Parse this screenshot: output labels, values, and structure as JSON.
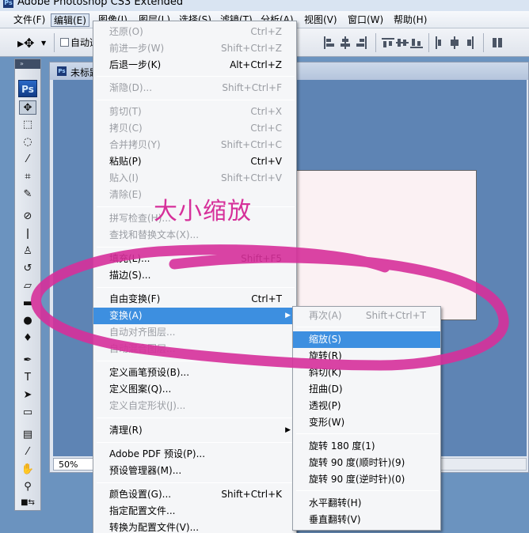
{
  "window": {
    "title": "Adobe Photoshop CS3 Extended",
    "logo_text": "Ps"
  },
  "menubar": [
    {
      "label": "文件(F)"
    },
    {
      "label": "编辑(E)"
    },
    {
      "label": "图像(I)"
    },
    {
      "label": "图层(L)"
    },
    {
      "label": "选择(S)"
    },
    {
      "label": "滤镜(T)"
    },
    {
      "label": "分析(A)"
    },
    {
      "label": "视图(V)"
    },
    {
      "label": "窗口(W)"
    },
    {
      "label": "帮助(H)"
    }
  ],
  "options_bar": {
    "auto_select_label": "自动选",
    "auto_select_checked": false
  },
  "toolbox": {
    "logo_text": "Ps",
    "grip_glyph": "»"
  },
  "document": {
    "title": "未标题-1",
    "zoom": "50%"
  },
  "edit_menu": {
    "items": [
      {
        "label": "还原(O)",
        "shortcut": "Ctrl+Z",
        "enabled": false
      },
      {
        "label": "前进一步(W)",
        "shortcut": "Shift+Ctrl+Z",
        "enabled": false
      },
      {
        "label": "后退一步(K)",
        "shortcut": "Alt+Ctrl+Z",
        "enabled": true
      },
      {
        "label": "渐隐(D)...",
        "shortcut": "Shift+Ctrl+F",
        "enabled": false
      },
      {
        "label": "剪切(T)",
        "shortcut": "Ctrl+X",
        "enabled": false
      },
      {
        "label": "拷贝(C)",
        "shortcut": "Ctrl+C",
        "enabled": false
      },
      {
        "label": "合并拷贝(Y)",
        "shortcut": "Shift+Ctrl+C",
        "enabled": false
      },
      {
        "label": "粘贴(P)",
        "shortcut": "Ctrl+V",
        "enabled": true
      },
      {
        "label": "贴入(I)",
        "shortcut": "Shift+Ctrl+V",
        "enabled": false
      },
      {
        "label": "清除(E)",
        "shortcut": "",
        "enabled": false
      },
      {
        "label": "拼写检查(H)...",
        "shortcut": "",
        "enabled": false
      },
      {
        "label": "查找和替换文本(X)...",
        "shortcut": "",
        "enabled": false
      },
      {
        "label": "填充(L)...",
        "shortcut": "Shift+F5",
        "enabled": true
      },
      {
        "label": "描边(S)...",
        "shortcut": "",
        "enabled": true
      },
      {
        "label": "自由变换(F)",
        "shortcut": "Ctrl+T",
        "enabled": true
      },
      {
        "label": "变换(A)",
        "shortcut": "",
        "enabled": true,
        "highlighted": true,
        "submenu": true
      },
      {
        "label": "自动对齐图层...",
        "shortcut": "",
        "enabled": false
      },
      {
        "label": "自动混合图层...",
        "shortcut": "",
        "enabled": false
      },
      {
        "label": "定义画笔预设(B)...",
        "shortcut": "",
        "enabled": true
      },
      {
        "label": "定义图案(Q)...",
        "shortcut": "",
        "enabled": true
      },
      {
        "label": "定义自定形状(J)...",
        "shortcut": "",
        "enabled": false
      },
      {
        "label": "清理(R)",
        "shortcut": "",
        "enabled": true,
        "submenu": true
      },
      {
        "label": "Adobe PDF 预设(P)...",
        "shortcut": "",
        "enabled": true
      },
      {
        "label": "预设管理器(M)...",
        "shortcut": "",
        "enabled": true
      },
      {
        "label": "颜色设置(G)...",
        "shortcut": "Shift+Ctrl+K",
        "enabled": true
      },
      {
        "label": "指定配置文件...",
        "shortcut": "",
        "enabled": true
      },
      {
        "label": "转换为配置文件(V)...",
        "shortcut": "",
        "enabled": true
      }
    ]
  },
  "transform_submenu": {
    "items": [
      {
        "label": "再次(A)",
        "shortcut": "Shift+Ctrl+T",
        "enabled": false
      },
      {
        "label": "缩放(S)",
        "shortcut": "",
        "enabled": true,
        "highlighted": true
      },
      {
        "label": "旋转(R)",
        "shortcut": "",
        "enabled": true
      },
      {
        "label": "斜切(K)",
        "shortcut": "",
        "enabled": true
      },
      {
        "label": "扭曲(D)",
        "shortcut": "",
        "enabled": true
      },
      {
        "label": "透视(P)",
        "shortcut": "",
        "enabled": true
      },
      {
        "label": "变形(W)",
        "shortcut": "",
        "enabled": true
      },
      {
        "label": "旋转 180 度(1)",
        "shortcut": "",
        "enabled": true
      },
      {
        "label": "旋转 90 度(顺时针)(9)",
        "shortcut": "",
        "enabled": true
      },
      {
        "label": "旋转 90 度(逆时针)(0)",
        "shortcut": "",
        "enabled": true
      },
      {
        "label": "水平翻转(H)",
        "shortcut": "",
        "enabled": true
      },
      {
        "label": "垂直翻转(V)",
        "shortcut": "",
        "enabled": true
      }
    ]
  },
  "annotation": {
    "text": "大小缩放",
    "color": "#d6309a"
  },
  "colors": {
    "menu_highlight": "#3d8fe0",
    "workspace": "#6b93bf",
    "canvas": "#fbf1f3"
  }
}
